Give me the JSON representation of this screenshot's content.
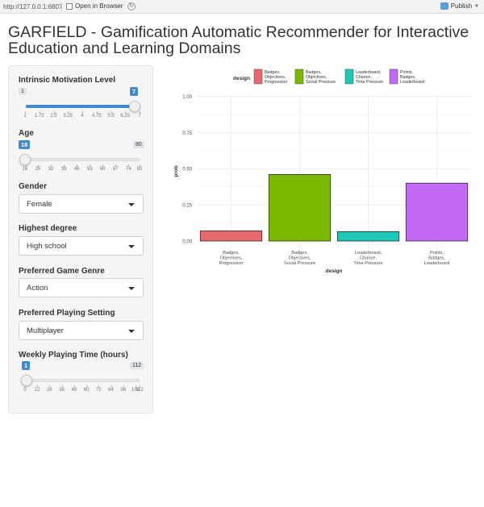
{
  "browser": {
    "url": "http://127.0.0.1:6807",
    "open_in_browser": "Open in Browser",
    "publish": "Publish"
  },
  "app": {
    "title": "GARFIELD - Gamification Automatic Recommender for Interactive Education and Learning Domains"
  },
  "inputs": {
    "motivation": {
      "label": "Intrinsic Motivation Level",
      "min": "1",
      "max": "7",
      "value": "7",
      "ticks": [
        "1",
        "1.75",
        "2.5",
        "3.25",
        "4",
        "4.75",
        "5.5",
        "6.25",
        "7"
      ]
    },
    "age": {
      "label": "Age",
      "min": "18",
      "max": "80",
      "value": "18",
      "ticks": [
        "18",
        "25",
        "32",
        "39",
        "46",
        "53",
        "60",
        "67",
        "74",
        "80"
      ]
    },
    "gender": {
      "label": "Gender",
      "value": "Female"
    },
    "degree": {
      "label": "Highest degree",
      "value": "High school"
    },
    "genre": {
      "label": "Preferred Game Genre",
      "value": "Action"
    },
    "setting": {
      "label": "Preferred Playing Setting",
      "value": "Multiplayer"
    },
    "playtime": {
      "label": "Weekly Playing Time (hours)",
      "min": "1",
      "max": "112",
      "value": "1",
      "ticks": [
        "0",
        "12",
        "24",
        "36",
        "48",
        "60",
        "72",
        "84",
        "96",
        "108",
        "112"
      ]
    }
  },
  "chart_data": {
    "type": "bar",
    "xlabel": "design",
    "ylabel": "prob",
    "legend_title": "design",
    "legend_position": "top",
    "ylim": [
      0,
      1
    ],
    "yticks": [
      "0.00",
      "0.25",
      "0.50",
      "0.75",
      "1.00"
    ],
    "grid": true,
    "categories": [
      [
        "Badges,",
        "Objectives,",
        "Progression"
      ],
      [
        "Badges,",
        "Objectives,",
        "Social Pressure"
      ],
      [
        "Leaderboard,",
        "Chance,",
        "Time Pressure"
      ],
      [
        "Points,",
        "Badges,",
        "Leaderboard"
      ]
    ],
    "values": [
      0.07,
      0.46,
      0.065,
      0.4
    ],
    "colors": [
      "#e8686f",
      "#7cb800",
      "#1ec8b8",
      "#c26af5"
    ]
  }
}
